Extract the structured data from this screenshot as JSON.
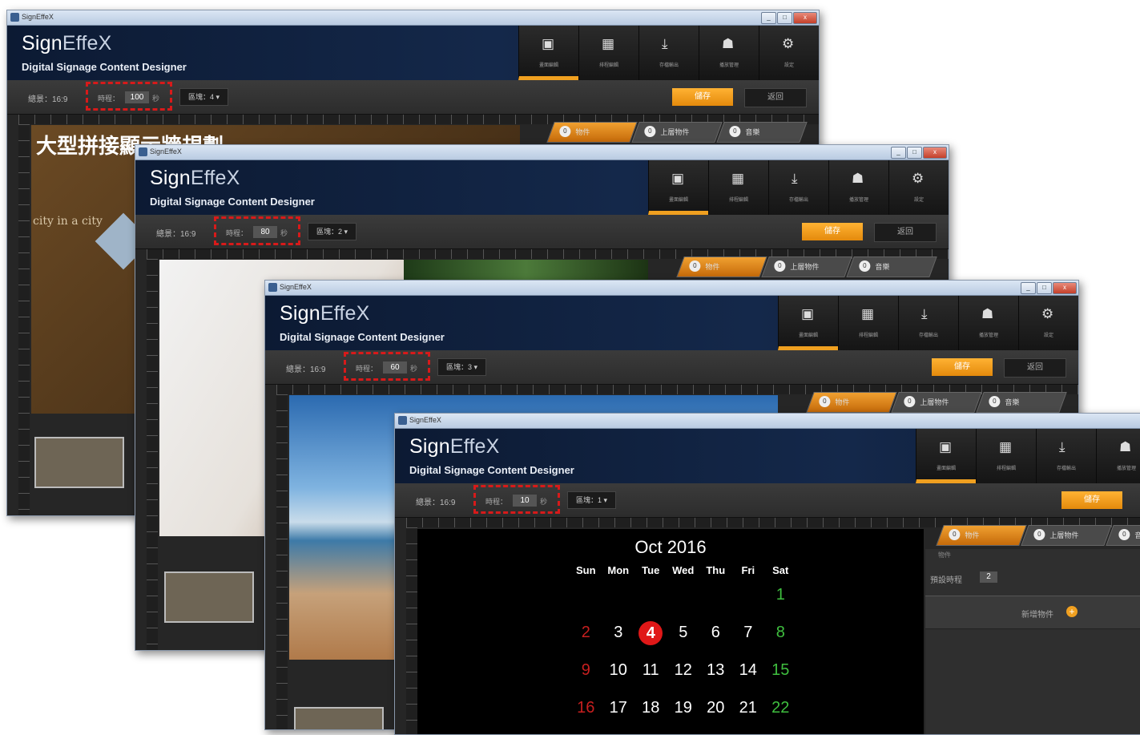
{
  "app": {
    "window_title": "SignEffeX",
    "logo_main": "Sign",
    "logo_accent": "EffeX",
    "subtitle": "Digital Signage Content Designer",
    "window_buttons": {
      "min": "_",
      "max": "□",
      "close": "x"
    }
  },
  "toolbar": [
    {
      "icon": "image-icon",
      "glyph": "▣",
      "label": "畫面編輯"
    },
    {
      "icon": "calendar-icon",
      "glyph": "▦",
      "label": "排程編輯"
    },
    {
      "icon": "download-icon",
      "glyph": "⤓",
      "label": "存檔輸出"
    },
    {
      "icon": "player-icon",
      "glyph": "☗",
      "label": "播放管理"
    },
    {
      "icon": "gear-icon",
      "glyph": "⚙",
      "label": "設定"
    }
  ],
  "controls": {
    "ratio_label": "總景：16:9",
    "duration_label": "時程：",
    "duration_unit": "秒",
    "orange_button": "儲存",
    "dark_button": "返回"
  },
  "tabs": [
    {
      "num": "0",
      "label": "物件"
    },
    {
      "num": "0",
      "label": "上層物件"
    },
    {
      "num": "0",
      "label": "音樂"
    }
  ],
  "windows": [
    {
      "duration": "100",
      "scene": "區塊：4 ▾",
      "canvas_title": "大型拼接顯示牆規劃",
      "canvas_sub": "city in a city"
    },
    {
      "duration": "80",
      "scene": "區塊：2 ▾"
    },
    {
      "duration": "60",
      "scene": "區塊：3 ▾"
    },
    {
      "duration": "10",
      "scene": "區塊：1 ▾"
    }
  ],
  "calendar": {
    "title": "Oct 2016",
    "weekdays": [
      "Sun",
      "Mon",
      "Tue",
      "Wed",
      "Thu",
      "Fri",
      "Sat"
    ],
    "weeks": [
      [
        "",
        "",
        "",
        "",
        "",
        "",
        "1"
      ],
      [
        "2",
        "3",
        "4",
        "5",
        "6",
        "7",
        "8"
      ],
      [
        "9",
        "10",
        "11",
        "12",
        "13",
        "14",
        "15"
      ],
      [
        "16",
        "17",
        "18",
        "19",
        "20",
        "21",
        "22"
      ]
    ],
    "today": "4"
  },
  "side_panel": {
    "object_label": "物件",
    "default_duration_label": "預設時程",
    "default_duration_value": "2",
    "add_object_label": "新增物件"
  },
  "colors": {
    "accent": "#f0a020",
    "highlight": "#d71a1a",
    "header": "#14284a"
  }
}
